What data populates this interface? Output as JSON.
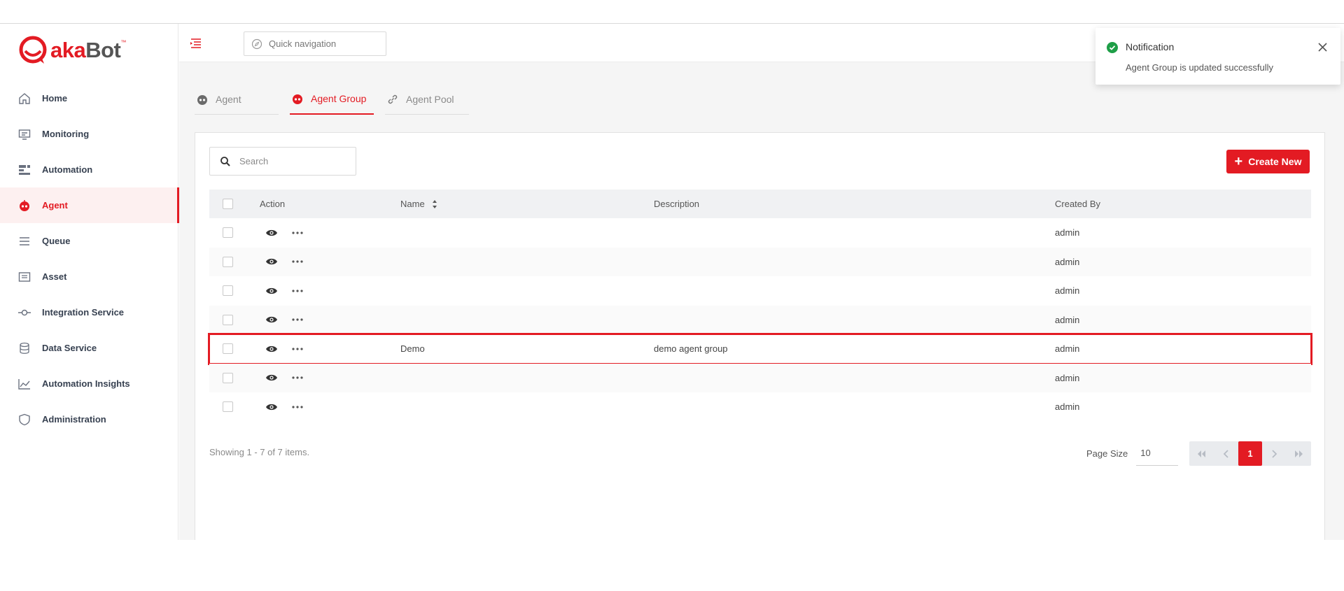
{
  "brand": {
    "logo_main": "aka",
    "logo_bot": "Bot",
    "logo_tm": "™",
    "accent": "#e31b23"
  },
  "sidebar": {
    "items": [
      {
        "label": "Home",
        "icon": "home-icon"
      },
      {
        "label": "Monitoring",
        "icon": "monitor-icon"
      },
      {
        "label": "Automation",
        "icon": "automation-icon"
      },
      {
        "label": "Agent",
        "icon": "robot-icon",
        "active": true
      },
      {
        "label": "Queue",
        "icon": "queue-icon"
      },
      {
        "label": "Asset",
        "icon": "asset-icon"
      },
      {
        "label": "Integration Service",
        "icon": "integration-icon"
      },
      {
        "label": "Data Service",
        "icon": "database-icon"
      },
      {
        "label": "Automation Insights",
        "icon": "chart-line-icon"
      },
      {
        "label": "Administration",
        "icon": "shield-icon"
      }
    ]
  },
  "header": {
    "quick_nav_placeholder": "Quick navigation"
  },
  "tabs": [
    {
      "label": "Agent",
      "icon": "robot-icon"
    },
    {
      "label": "Agent Group",
      "icon": "robot-icon",
      "active": true
    },
    {
      "label": "Agent Pool",
      "icon": "link-icon"
    }
  ],
  "toolbar": {
    "search_placeholder": "Search",
    "create_label": "Create New"
  },
  "table": {
    "columns": {
      "action": "Action",
      "name": "Name",
      "description": "Description",
      "created_by": "Created By"
    },
    "rows": [
      {
        "name": "",
        "description": "",
        "created_by": "admin"
      },
      {
        "name": "",
        "description": "",
        "created_by": "admin"
      },
      {
        "name": "",
        "description": "",
        "created_by": "admin"
      },
      {
        "name": "",
        "description": "",
        "created_by": "admin"
      },
      {
        "name": "Demo",
        "description": "demo agent group",
        "created_by": "admin",
        "highlighted": true
      },
      {
        "name": "",
        "description": "",
        "created_by": "admin"
      },
      {
        "name": "",
        "description": "",
        "created_by": "admin"
      }
    ]
  },
  "footer": {
    "showing": "Showing 1 - 7 of 7 items.",
    "page_size_label": "Page Size",
    "page_size_value": "10",
    "current_page": "1"
  },
  "notification": {
    "title": "Notification",
    "message": "Agent Group is updated successfully"
  }
}
